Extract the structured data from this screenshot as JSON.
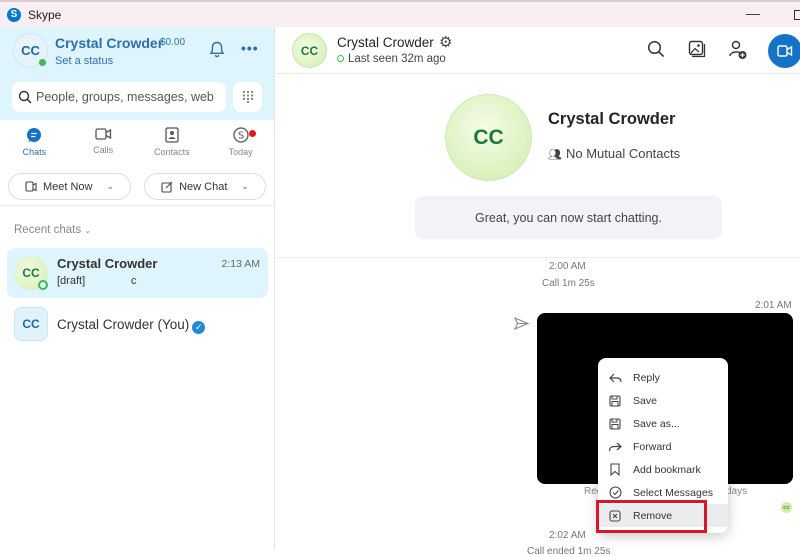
{
  "window": {
    "app_title": "Skype",
    "minimize_label": "—"
  },
  "sidebar": {
    "profile": {
      "initials": "CC",
      "name": "Crystal Crowder",
      "credit": "$0.00",
      "status": "Set a status"
    },
    "search": {
      "placeholder": "People, groups, messages, web"
    },
    "tabs": [
      {
        "label": "Chats",
        "icon": "chat-bubble-icon",
        "active": true
      },
      {
        "label": "Calls",
        "icon": "video-camera-icon",
        "active": false
      },
      {
        "label": "Contacts",
        "icon": "contact-book-icon",
        "active": false
      },
      {
        "label": "Today",
        "icon": "skype-logo-icon",
        "active": false,
        "notification": true
      }
    ],
    "actions": {
      "meet_now": "Meet Now",
      "new_chat": "New Chat"
    },
    "recent_label": "Recent chats",
    "chats": [
      {
        "initials": "CC",
        "name": "Crystal Crowder",
        "time": "2:13 AM",
        "preview": "[draft]",
        "preview_extra": "c",
        "active": true
      },
      {
        "initials": "CC",
        "name": "Crystal Crowder (You)",
        "verified": true,
        "active": false
      }
    ]
  },
  "conversation": {
    "header": {
      "initials": "CC",
      "name": "Crystal Crowder",
      "last_seen": "Last seen 32m ago"
    },
    "profile": {
      "initials": "CC",
      "name": "Crystal Crowder",
      "mutual": "No Mutual Contacts"
    },
    "notice": "Great, you can now start chatting.",
    "messages": [
      {
        "time": "2:00 AM",
        "text": "Call 1m 25s"
      },
      {
        "time": "2:01 AM",
        "type": "media",
        "caption_left": "Rec",
        "caption_right": "days",
        "read_by": "CC"
      },
      {
        "time": "2:02 AM",
        "text": "Call ended 1m 25s"
      }
    ]
  },
  "context_menu": {
    "items": [
      {
        "label": "Reply",
        "icon": "reply-icon"
      },
      {
        "label": "Save",
        "icon": "save-icon"
      },
      {
        "label": "Save as...",
        "icon": "save-as-icon"
      },
      {
        "label": "Forward",
        "icon": "forward-icon"
      },
      {
        "label": "Add bookmark",
        "icon": "bookmark-icon"
      },
      {
        "label": "Select Messages",
        "icon": "select-check-icon"
      },
      {
        "label": "Remove",
        "icon": "remove-icon",
        "highlighted": true
      }
    ]
  },
  "colors": {
    "accent": "#1473c7",
    "sidebar_bg": "#dff5fd",
    "presence": "#3fb950",
    "highlight": "#d6192a"
  }
}
